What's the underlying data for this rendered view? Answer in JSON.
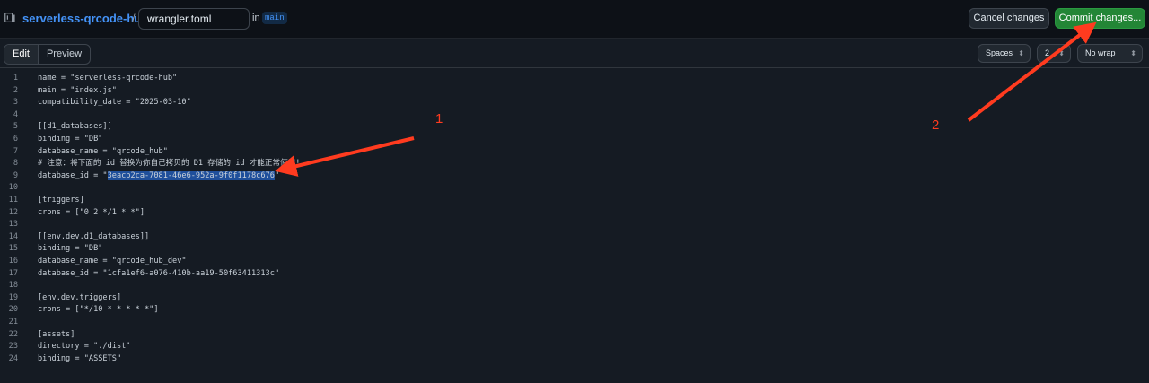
{
  "header": {
    "repo_name": "serverless-qrcode-hub",
    "separator": "/",
    "filename": "wrangler.toml",
    "in_label": "in",
    "branch": "main",
    "cancel_label": "Cancel changes",
    "commit_label": "Commit changes..."
  },
  "editor_toolbar": {
    "tabs": [
      {
        "label": "Edit",
        "active": true
      },
      {
        "label": "Preview",
        "active": false
      }
    ],
    "indent_mode": "Spaces",
    "indent_size": "2",
    "wrap_mode": "No wrap"
  },
  "code_lines": [
    {
      "num": "1",
      "text": "name = \"serverless-qrcode-hub\""
    },
    {
      "num": "2",
      "text": "main = \"index.js\""
    },
    {
      "num": "3",
      "text": "compatibility_date = \"2025-03-10\""
    },
    {
      "num": "4",
      "text": ""
    },
    {
      "num": "5",
      "text": "[[d1_databases]]"
    },
    {
      "num": "6",
      "text": "binding = \"DB\""
    },
    {
      "num": "7",
      "text": "database_name = \"qrcode_hub\""
    },
    {
      "num": "8",
      "text": "# 注意：将下面的 id 替换为你自己拷贝的 D1 存储的 id 才能正常使用!"
    },
    {
      "num": "9",
      "text_before": "database_id = \"",
      "text_selected": "3eacb2ca-7081-46e6-952a-9f0f1178c676",
      "text_after": "\""
    },
    {
      "num": "10",
      "text": ""
    },
    {
      "num": "11",
      "text": "[triggers]"
    },
    {
      "num": "12",
      "text": "crons = [\"0 2 */1 * *\"]"
    },
    {
      "num": "13",
      "text": ""
    },
    {
      "num": "14",
      "text": "[[env.dev.d1_databases]]"
    },
    {
      "num": "15",
      "text": "binding = \"DB\""
    },
    {
      "num": "16",
      "text": "database_name = \"qrcode_hub_dev\""
    },
    {
      "num": "17",
      "text": "database_id = \"1cfa1ef6-a076-410b-aa19-50f63411313c\""
    },
    {
      "num": "18",
      "text": ""
    },
    {
      "num": "19",
      "text": "[env.dev.triggers]"
    },
    {
      "num": "20",
      "text": "crons = [\"*/10 * * * * *\"]"
    },
    {
      "num": "21",
      "text": ""
    },
    {
      "num": "22",
      "text": "[assets]"
    },
    {
      "num": "23",
      "text": "directory = \"./dist\""
    },
    {
      "num": "24",
      "text": "binding = \"ASSETS\""
    }
  ],
  "annotations": {
    "label_1": "1",
    "label_2": "2",
    "color": "#ff3b1f"
  },
  "icons": {
    "repo": "repo-icon",
    "dropdown": "select-arrows-icon"
  }
}
